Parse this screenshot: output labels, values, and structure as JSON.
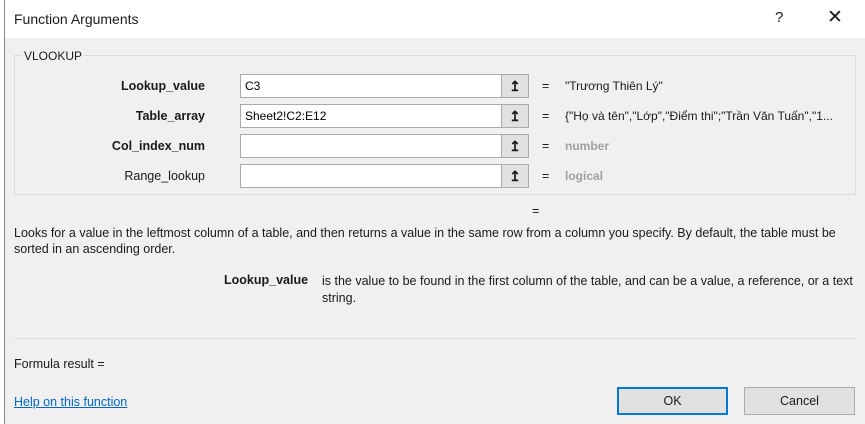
{
  "title": "Function Arguments",
  "help_label": "?",
  "close_label": "✕",
  "function_name": "VLOOKUP",
  "ref_icon": "↥",
  "args": [
    {
      "label": "Lookup_value",
      "value": "C3",
      "eq": "=",
      "result": "\"Trương Thiên Lý\""
    },
    {
      "label": "Table_array",
      "value": "Sheet2!C2:E12",
      "eq": "=",
      "result": "{\"Họ và tên\",\"Lớp\",\"Điểm thi\";\"Trần Văn Tuấn\",\"1..."
    },
    {
      "label": "Col_index_num",
      "value": "",
      "eq": "=",
      "result": "number"
    },
    {
      "label": "Range_lookup",
      "value": "",
      "eq": "=",
      "result": "logical"
    }
  ],
  "overall_eq": "=",
  "description": "Looks for a value in the leftmost column of a table, and then returns a value in the same row from a column you specify. By default, the table must be sorted in an ascending order.",
  "arg_help_name": "Lookup_value",
  "arg_help_text": "is the value to be found in the first column of the table, and can be a value, a reference, or a text string.",
  "formula_result": "Formula result =",
  "help_link": "Help on this function",
  "ok_label": "OK",
  "cancel_label": "Cancel"
}
